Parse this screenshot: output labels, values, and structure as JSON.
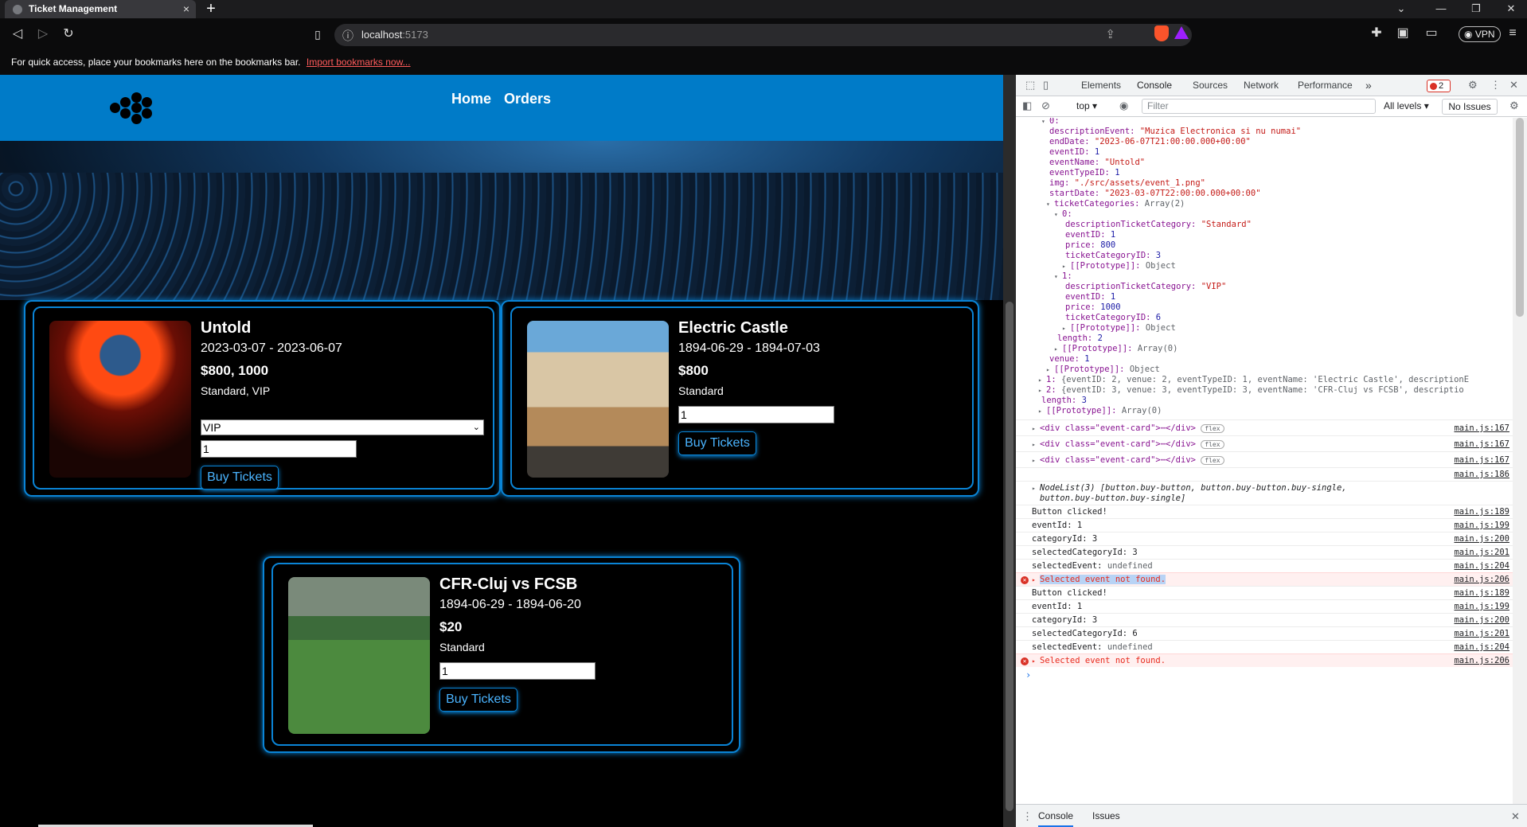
{
  "browser": {
    "tab_title": "Ticket Management",
    "tab_close": "×",
    "new_tab": "+",
    "url_host": "localhost",
    "url_port": ":5173",
    "vpn_label": "VPN",
    "bookmarks_text": "For quick access, place your bookmarks here on the bookmarks bar.",
    "bookmarks_link": "Import bookmarks now..."
  },
  "site": {
    "nav": {
      "home": "Home",
      "orders": "Orders"
    },
    "events": [
      {
        "name": "Untold",
        "dates": "2023-03-07 - 2023-06-07",
        "prices": "$800, 1000",
        "categories": "Standard, VIP",
        "selected_category": "VIP",
        "quantity": "1",
        "buy_label": "Buy Tickets"
      },
      {
        "name": "Electric Castle",
        "dates": "1894-06-29 - 1894-07-03",
        "prices": "$800",
        "categories": "Standard",
        "quantity": "1",
        "buy_label": "Buy Tickets"
      },
      {
        "name": "CFR-Cluj vs FCSB",
        "dates": "1894-06-29 - 1894-06-20",
        "prices": "$20",
        "categories": "Standard",
        "quantity": "1",
        "buy_label": "Buy Tickets"
      }
    ]
  },
  "devtools": {
    "tabs": [
      "Elements",
      "Console",
      "Sources",
      "Network",
      "Performance"
    ],
    "more": "»",
    "error_count": "2",
    "context": "top",
    "filter_placeholder": "Filter",
    "levels": "All levels",
    "issues": "No Issues",
    "drawer_tabs": [
      "Console",
      "Issues"
    ],
    "object_lines": [
      {
        "indent": 3,
        "tri": "▾",
        "key": "0",
        "val": "",
        "vtype": ""
      },
      {
        "indent": 4,
        "key": "descriptionEvent",
        "val": "\"Muzica Electronica si nu numai\"",
        "vtype": "s"
      },
      {
        "indent": 4,
        "key": "endDate",
        "val": "\"2023-06-07T21:00:00.000+00:00\"",
        "vtype": "s"
      },
      {
        "indent": 4,
        "key": "eventID",
        "val": "1",
        "vtype": "n"
      },
      {
        "indent": 4,
        "key": "eventName",
        "val": "\"Untold\"",
        "vtype": "s"
      },
      {
        "indent": 4,
        "key": "eventTypeID",
        "val": "1",
        "vtype": "n"
      },
      {
        "indent": 4,
        "key": "img",
        "val": "\"./src/assets/event_1.png\"",
        "vtype": "s"
      },
      {
        "indent": 4,
        "key": "startDate",
        "val": "\"2023-03-07T22:00:00.000+00:00\"",
        "vtype": "s"
      },
      {
        "indent": 3.6,
        "tri": "▾",
        "key": "ticketCategories",
        "val": "Array(2)",
        "vtype": "p"
      },
      {
        "indent": 4.6,
        "tri": "▾",
        "key": "0",
        "val": "",
        "vtype": ""
      },
      {
        "indent": 6,
        "key": "descriptionTicketCategory",
        "val": "\"Standard\"",
        "vtype": "s"
      },
      {
        "indent": 6,
        "key": "eventID",
        "val": "1",
        "vtype": "n"
      },
      {
        "indent": 6,
        "key": "price",
        "val": "800",
        "vtype": "n"
      },
      {
        "indent": 6,
        "key": "ticketCategoryID",
        "val": "3",
        "vtype": "n"
      },
      {
        "indent": 5.6,
        "tri": "▸",
        "key": "[[Prototype]]",
        "val": "Object",
        "vtype": "p"
      },
      {
        "indent": 4.6,
        "tri": "▾",
        "key": "1",
        "val": "",
        "vtype": ""
      },
      {
        "indent": 6,
        "key": "descriptionTicketCategory",
        "val": "\"VIP\"",
        "vtype": "s"
      },
      {
        "indent": 6,
        "key": "eventID",
        "val": "1",
        "vtype": "n"
      },
      {
        "indent": 6,
        "key": "price",
        "val": "1000",
        "vtype": "n"
      },
      {
        "indent": 6,
        "key": "ticketCategoryID",
        "val": "6",
        "vtype": "n"
      },
      {
        "indent": 5.6,
        "tri": "▸",
        "key": "[[Prototype]]",
        "val": "Object",
        "vtype": "p"
      },
      {
        "indent": 5,
        "key": "length",
        "val": "2",
        "vtype": "n"
      },
      {
        "indent": 4.6,
        "tri": "▸",
        "key": "[[Prototype]]",
        "val": "Array(0)",
        "vtype": "p"
      },
      {
        "indent": 4,
        "key": "venue",
        "val": "1",
        "vtype": "n"
      },
      {
        "indent": 3.6,
        "tri": "▸",
        "key": "[[Prototype]]",
        "val": "Object",
        "vtype": "p"
      },
      {
        "indent": 2.6,
        "tri": "▸",
        "key": "1",
        "val": "{eventID: 2, venue: 2, eventTypeID: 1, eventName: 'Electric Castle', descriptionE",
        "vtype": "p"
      },
      {
        "indent": 2.6,
        "tri": "▸",
        "key": "2",
        "val": "{eventID: 3, venue: 3, eventTypeID: 3, eventName: 'CFR-Cluj vs FCSB', descriptio",
        "vtype": "p"
      },
      {
        "indent": 3,
        "key": "length",
        "val": "3",
        "vtype": "n"
      },
      {
        "indent": 2.6,
        "tri": "▸",
        "key": "[[Prototype]]",
        "val": "Array(0)",
        "vtype": "p"
      }
    ],
    "messages": [
      {
        "text": "<div class=\"event-card\">⋯</div>",
        "pill": "flex",
        "src": "main.js:167",
        "kind": "node"
      },
      {
        "text": "<div class=\"event-card\">⋯</div>",
        "pill": "flex",
        "src": "main.js:167",
        "kind": "node"
      },
      {
        "text": "<div class=\"event-card\">⋯</div>",
        "pill": "flex",
        "src": "main.js:167",
        "kind": "node"
      },
      {
        "text": "",
        "src": "main.js:186",
        "kind": "blank"
      },
      {
        "text": "NodeList(3) [button.buy-button, button.buy-button.buy-single,",
        "text2": "button.buy-button.buy-single]",
        "kind": "nodelist"
      },
      {
        "text": "Button clicked!",
        "src": "main.js:189",
        "kind": "log"
      },
      {
        "text": "eventId: 1",
        "src": "main.js:199",
        "kind": "log"
      },
      {
        "text": "categoryId: 3",
        "src": "main.js:200",
        "kind": "log"
      },
      {
        "text": "selectedCategoryId: 3",
        "src": "main.js:201",
        "kind": "log"
      },
      {
        "text": "selectedEvent: ",
        "undef": "undefined",
        "src": "main.js:204",
        "kind": "log"
      },
      {
        "text": "Selected event not found.",
        "src": "main.js:206",
        "kind": "error",
        "highlight": true
      },
      {
        "text": "Button clicked!",
        "src": "main.js:189",
        "kind": "log"
      },
      {
        "text": "eventId: 1",
        "src": "main.js:199",
        "kind": "log"
      },
      {
        "text": "categoryId: 3",
        "src": "main.js:200",
        "kind": "log"
      },
      {
        "text": "selectedCategoryId: 6",
        "src": "main.js:201",
        "kind": "log"
      },
      {
        "text": "selectedEvent: ",
        "undef": "undefined",
        "src": "main.js:204",
        "kind": "log"
      },
      {
        "text": "Selected event not found.",
        "src": "main.js:206",
        "kind": "error",
        "highlight": false
      }
    ],
    "prompt": "›"
  }
}
